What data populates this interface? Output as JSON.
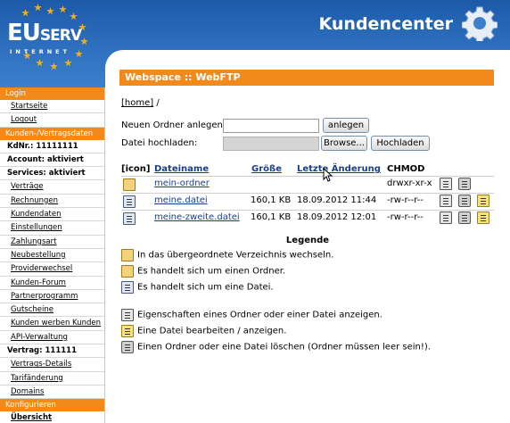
{
  "header": {
    "logo_main": "EU",
    "logo_small": "SERV",
    "logo_sub": "INTERNET",
    "title": "Kundencenter",
    "bg_color": "#2e70bf",
    "star_color": "#f0b020"
  },
  "sidebar": {
    "login_head": "Login",
    "login_items": [
      "Startseite",
      "Logout"
    ],
    "data_head": "Kunden-/Vertragsdaten",
    "kdnr": "KdNr.: 11111111",
    "account": "Account: aktiviert",
    "services": "Services: aktiviert",
    "data_items": [
      "Verträge",
      "Rechnungen",
      "Kundendaten",
      "Einstellungen",
      "Zahlungsart",
      "Neubestellung",
      "Providerwechsel",
      "Kunden-Forum",
      "Partnerprogramm",
      "Gutscheine",
      "Kunden werben Kunden",
      "API-Verwaltung"
    ],
    "vertrag": "Vertrag: 111111",
    "vertrag_items": [
      "Vertrags-Details",
      "Tarifänderung",
      "Domains"
    ],
    "config_head": "Konfigurieren",
    "config_items": [
      "Übersicht"
    ],
    "accent_color": "#f18a1a"
  },
  "main": {
    "title": "Webspace :: WebFTP",
    "breadcrumb_home": "[home]",
    "breadcrumb_sep": "/",
    "new_folder_label": "Neuen Ordner anlegen:",
    "new_folder_value": "",
    "new_folder_button": "anlegen",
    "upload_label": "Datei hochladen:",
    "browse_button": "Browse...",
    "upload_button": "Hochladen",
    "table": {
      "headers": {
        "icon": "[icon]",
        "name": "Dateiname",
        "size": "Größe",
        "changed": "Letzte Änderung",
        "chmod": "CHMOD"
      },
      "rows": [
        {
          "type": "folder",
          "name": "mein-ordner",
          "size": "",
          "changed": "",
          "chmod": "drwxr-xr-x"
        },
        {
          "type": "file",
          "name": "meine.datei",
          "size": "160,1 KB",
          "changed": "18.09.2012 11:44",
          "chmod": "-rw-r--r--"
        },
        {
          "type": "file",
          "name": "meine-zweite.datei",
          "size": "160,1 KB",
          "changed": "18.09.2012 12:01",
          "chmod": "-rw-r--r--"
        }
      ]
    },
    "legend": {
      "title": "Legende",
      "items": [
        "In das übergeordnete Verzeichnis wechseln.",
        "Es handelt sich um einen Ordner.",
        "Es handelt sich um eine Datei.",
        "Eigenschaften eines Ordner oder einer Datei anzeigen.",
        "Eine Datei bearbeiten / anzeigen.",
        "Einen Ordner oder eine Datei löschen (Ordner müssen leer sein!)."
      ]
    }
  }
}
